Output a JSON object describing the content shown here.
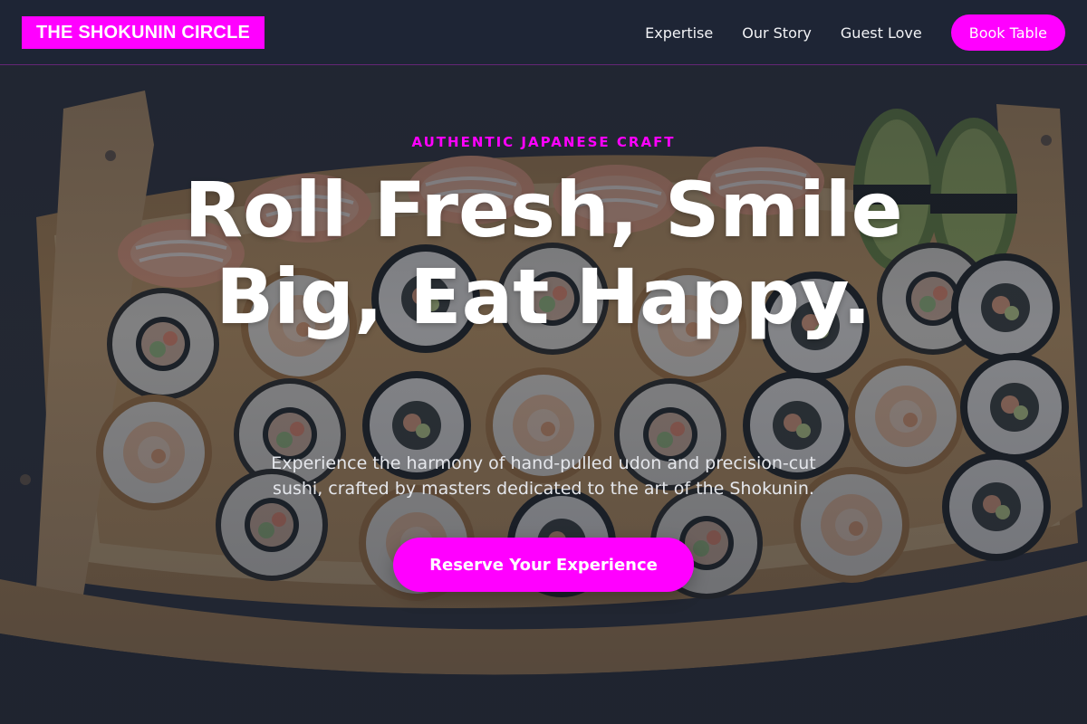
{
  "header": {
    "brand": "THE SHOKUNIN CIRCLE",
    "nav": [
      {
        "label": "Expertise"
      },
      {
        "label": "Our Story"
      },
      {
        "label": "Guest Love"
      }
    ],
    "cta_label": "Book Table"
  },
  "hero": {
    "eyebrow": "AUTHENTIC JAPANESE CRAFT",
    "headline": "Roll Fresh, Smile Big, Eat Happy.",
    "subtext": "Experience the harmony of hand-pulled udon and precision-cut sushi, crafted by masters dedicated to the art of the Shokunin.",
    "cta_label": "Reserve Your Experience",
    "background_image": "sushi-boat-photo"
  },
  "colors": {
    "accent": "#ff00ff",
    "navbar_bg": "#1e2636",
    "text_primary": "#ffffff",
    "text_secondary": "#e5e7ec"
  }
}
